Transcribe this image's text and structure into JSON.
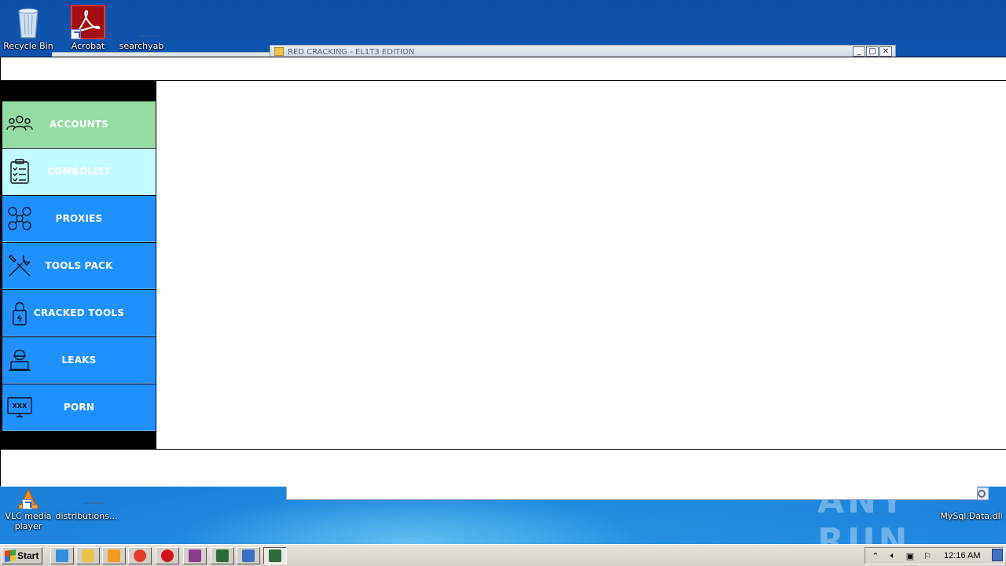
{
  "desktop": {
    "icons": [
      {
        "label": "Recycle Bin"
      },
      {
        "label": "Acrobat"
      },
      {
        "label": "searchyab"
      },
      {
        "label": "VLC media player"
      },
      {
        "label": "distributions..."
      },
      {
        "label": "MySql.Data.dll"
      }
    ],
    "watermark": "ANY RUN"
  },
  "background_window": {
    "title": "RED CRACKING - EL1T3 EDITION",
    "controls": {
      "minimize": "_",
      "maximize": "□",
      "close": "✕"
    }
  },
  "app": {
    "nav": [
      {
        "label": "ACCOUNTS",
        "icon": "users-group-icon",
        "color": "#95dba4",
        "state": "selected"
      },
      {
        "label": "COMBOLIST",
        "icon": "clipboard-checklist-icon",
        "color": "#c2fbff",
        "state": "hover"
      },
      {
        "label": "PROXIES",
        "icon": "network-nodes-icon",
        "color": "#1e90ff"
      },
      {
        "label": "TOOLS PACK",
        "icon": "wrench-screwdriver-icon",
        "color": "#1e90ff"
      },
      {
        "label": "CRACKED TOOLS",
        "icon": "padlock-icon",
        "color": "#1e90ff"
      },
      {
        "label": "LEAKS",
        "icon": "hacker-laptop-icon",
        "color": "#1e90ff"
      },
      {
        "label": "PORN",
        "icon": "xxx-monitor-icon",
        "color": "#1e90ff"
      }
    ]
  },
  "taskbar": {
    "start_label": "Start",
    "buttons": [
      {
        "icon": "internet-explorer-icon",
        "color": "#2f8fe0"
      },
      {
        "icon": "file-explorer-icon",
        "color": "#e8c14a"
      },
      {
        "icon": "media-player-icon",
        "color": "#f39a1f"
      },
      {
        "icon": "chrome-icon",
        "color": "#e23b2e"
      },
      {
        "icon": "opera-icon",
        "color": "#d3121c"
      },
      {
        "icon": "winrar-icon",
        "color": "#8b3a8f"
      },
      {
        "icon": "app-bug-icon",
        "color": "#2f6b3a"
      },
      {
        "icon": "window-app-icon",
        "color": "#3a6fc4"
      },
      {
        "icon": "app-bug-icon",
        "color": "#2f6b3a",
        "active": true
      }
    ],
    "tray": {
      "clock": "12:16 AM"
    }
  }
}
